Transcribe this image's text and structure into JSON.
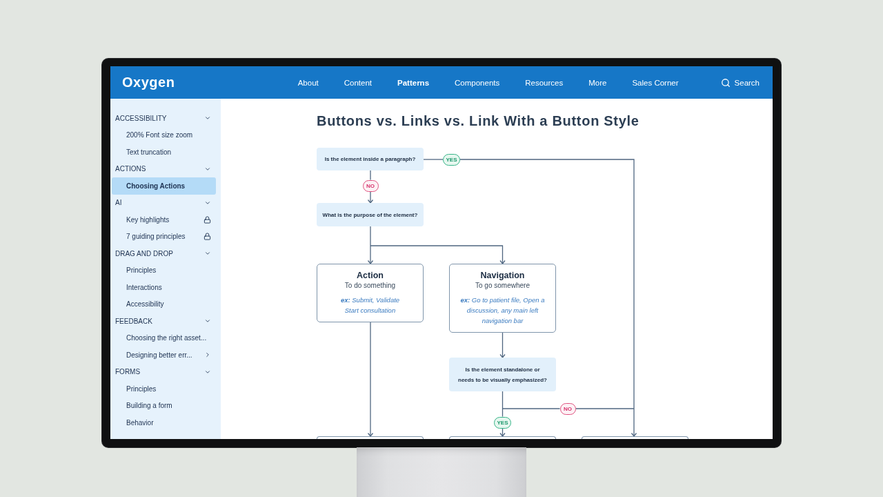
{
  "header": {
    "logo": "Oxygen",
    "nav": [
      {
        "label": "About",
        "selected": false
      },
      {
        "label": "Content",
        "selected": false
      },
      {
        "label": "Patterns",
        "selected": true
      },
      {
        "label": "Components",
        "selected": false
      },
      {
        "label": "Resources",
        "selected": false
      },
      {
        "label": "More",
        "selected": false
      },
      {
        "label": "Sales Corner",
        "selected": false
      }
    ],
    "search": {
      "label": "Search"
    }
  },
  "sidebar": {
    "sections": [
      {
        "label": "ACCESSIBILITY",
        "expanded": true,
        "children": [
          {
            "label": "200% Font size zoom",
            "kind": "page",
            "selected": false
          },
          {
            "label": "Text truncation",
            "kind": "page",
            "selected": false
          }
        ]
      },
      {
        "label": "ACTIONS",
        "expanded": true,
        "children": [
          {
            "label": "Choosing Actions",
            "kind": "page",
            "selected": true
          }
        ]
      },
      {
        "label": "AI",
        "expanded": true,
        "children": [
          {
            "label": "Key highlights",
            "kind": "locked",
            "selected": false
          },
          {
            "label": "7 guiding principles",
            "kind": "locked",
            "selected": false
          }
        ]
      },
      {
        "label": "DRAG AND DROP",
        "expanded": true,
        "children": [
          {
            "label": "Principles",
            "kind": "page",
            "selected": false
          },
          {
            "label": "Interactions",
            "kind": "page",
            "selected": false
          },
          {
            "label": "Accessibility",
            "kind": "page",
            "selected": false
          }
        ]
      },
      {
        "label": "FEEDBACK",
        "expanded": true,
        "children": [
          {
            "label": "Choosing the right asset...",
            "kind": "page",
            "selected": false
          },
          {
            "label": "Designing better err...",
            "kind": "submenu",
            "selected": false
          }
        ]
      },
      {
        "label": "FORMS",
        "expanded": true,
        "children": [
          {
            "label": "Principles",
            "kind": "page",
            "selected": false
          },
          {
            "label": "Building a form",
            "kind": "page",
            "selected": false
          },
          {
            "label": "Behavior",
            "kind": "page",
            "selected": false
          }
        ]
      }
    ]
  },
  "page": {
    "title": "Buttons vs. Links vs. Link With a Button Style",
    "flowchart": {
      "nodes": [
        {
          "kind": "question",
          "text": "Is the element inside a paragraph?"
        },
        {
          "kind": "question",
          "text": "What is the purpose of the element?"
        },
        {
          "kind": "answer",
          "title": "Action",
          "subtitle": "To do something",
          "example": "**ex:** Submit, Validate\nStart consultation"
        },
        {
          "kind": "answer",
          "title": "Navigation",
          "subtitle": "To go somewhere",
          "example": "**ex:** Go to patient file, Open a\ndiscussion, any main left\nnavigation bar"
        },
        {
          "kind": "question",
          "text": "Is the element standalone or\nneeds to be visually emphasized?"
        },
        {
          "kind": "cut_off"
        },
        {
          "kind": "cut_off"
        },
        {
          "kind": "cut_off"
        }
      ],
      "labels": [
        {
          "text": "YES",
          "kind": "yes"
        },
        {
          "text": "NO",
          "kind": "no"
        },
        {
          "text": "NO",
          "kind": "no"
        },
        {
          "text": "YES",
          "kind": "yes"
        }
      ]
    }
  }
}
